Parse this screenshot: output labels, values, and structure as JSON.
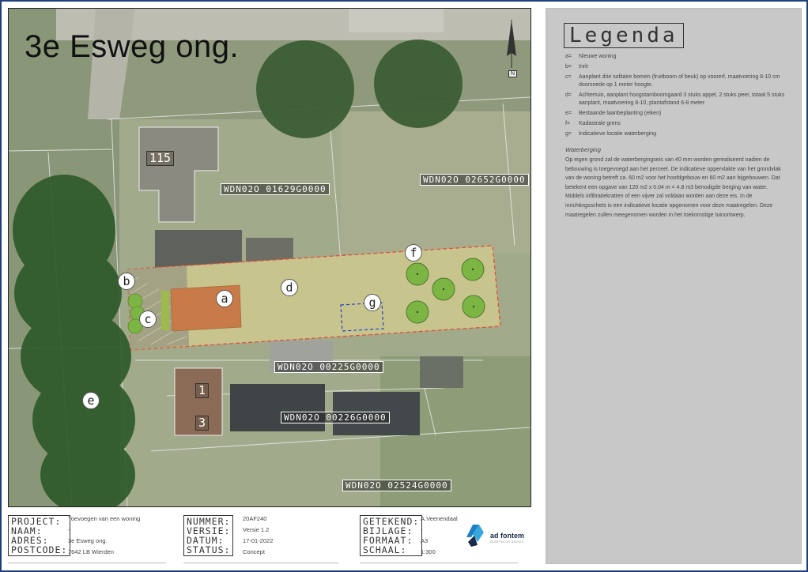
{
  "map": {
    "title": "3e Esweg ong.",
    "parcels": [
      "WDN02O 01629G0000",
      "WDN02O 02652G0000",
      "WDN02O 00225G0000",
      "WDN02O 00226G0000",
      "WDN02O 02524G0000"
    ],
    "house_numbers": [
      "115",
      "1",
      "3"
    ],
    "markers": [
      "a",
      "b",
      "c",
      "d",
      "e",
      "f",
      "g"
    ],
    "north_label": "N"
  },
  "legend": {
    "title": "Legenda",
    "items": [
      {
        "key": "a=",
        "text": "Nieuwe woning"
      },
      {
        "key": "b=",
        "text": "Inrit"
      },
      {
        "key": "c=",
        "text": "Aanplant drie solitaire bomen (fruitboom of beuk) op voorerf, maatvoering 8-10 cm doorsnede op 1 meter hoogte."
      },
      {
        "key": "d=",
        "text": "Achtertuin,  aanplant hoogstamboomgaard 3 stuks appel, 2 stuks peer, totaal 5 stuks aanplant, maatvoering 8-10, plantafstand 6-8 meter."
      },
      {
        "key": "e=",
        "text": "Bestaande laanbeplanting (eiken)"
      },
      {
        "key": "f=",
        "text": "Kadastrale grens"
      },
      {
        "key": "g=",
        "text": "Indicatieve locatie waterberging"
      }
    ],
    "water_heading": "Waterberging",
    "water_text": "Op eigen grond zal de waterbergingseis van 40 mm worden gerealiseerd nadien de bebouwing is toegevoegd aan het perceel. De indicatieve oppervlakte van het grondvlak van de woning betreft ca. 60 m2 voor het hoofdgebouw en 60 m2 aan bijgebouwen. Dat betekent een opgave van 120 m2 x 0.04 m = 4.8 m3 benodigde berging van water. Middels infiltratiekratten of een vijver zal voldaan worden aan deze eis. In de inrichtingsschets is een indicatieve locatie opgenomen voor deze maatregelen. Deze maatregelen zullen meegenomen worden in het toekomstige tuinontwerp."
  },
  "titleblock": {
    "col1_labels": [
      "PROJECT:",
      "NAAM:",
      "ADRES:",
      "POSTCODE:"
    ],
    "col1_values": [
      "Toevoegen van een woning",
      "-",
      "3e Esweg ong.",
      "7642 LB Wierden"
    ],
    "col2_labels": [
      "NUMMER:",
      "VERSIE:",
      "DATUM:",
      "STATUS:"
    ],
    "col2_values": [
      "20AF240",
      "Versie 1.2",
      "17-01-2022",
      "Concept"
    ],
    "col3_labels": [
      "GETEKEND:",
      "BIJLAGE:",
      "FORMAAT:",
      "SCHAAL:"
    ],
    "col3_values": [
      "A.Veenendaal",
      "-",
      "A3",
      "1:300"
    ],
    "logo_text": "ad fontem",
    "logo_sub": "RUIMTELIJK ADVIES"
  },
  "colors": {
    "border": "#1f3f7a",
    "plot_fill": "#c8c48e",
    "house_fill": "#c87a48",
    "cadastral_line": "#e0503a",
    "tree_dark": "#2e5a2a",
    "fruit_tree": "#7db545",
    "water_outline": "#2244cc",
    "legend_bg": "#c8c8c8"
  }
}
